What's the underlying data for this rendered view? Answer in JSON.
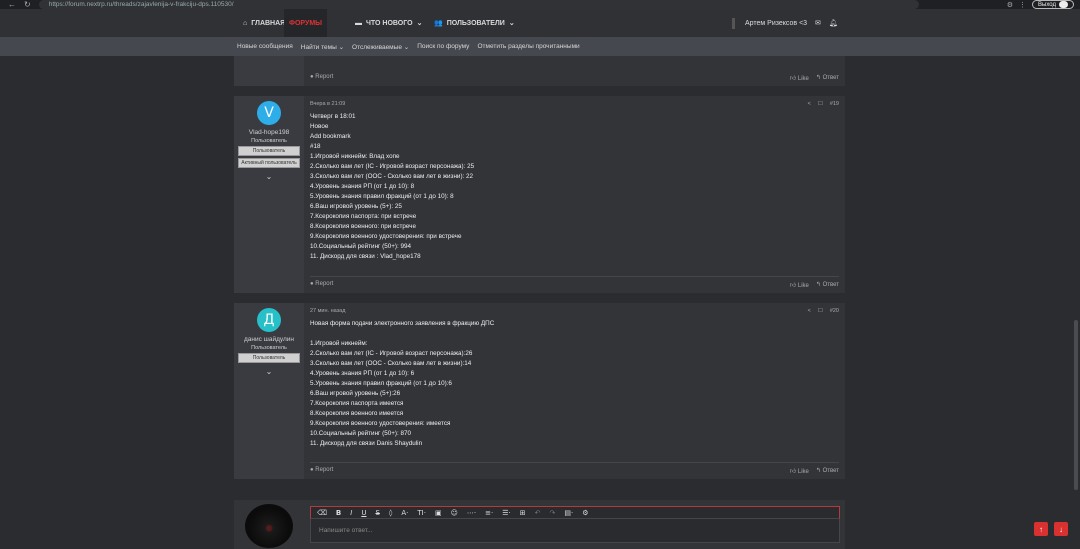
{
  "browser": {
    "url": "https://forum.nextrp.ru/threads/zajavlenija-v-frakciju-dps.110530/",
    "exit_label": "Выход"
  },
  "nav": {
    "home": "ГЛАВНАЯ",
    "forums": "ФОРУМЫ",
    "whats_new": "ЧТО НОВОГО",
    "users": "ПОЛЬЗОВАТЕЛИ",
    "username": "Артем Ризексов <3"
  },
  "subnav": [
    "Новые сообщения",
    "Найти темы",
    "Отслеживаемые",
    "Поиск по форуму",
    "Отметить разделы прочитанными"
  ],
  "top_post_footer": {
    "report": "Report",
    "like": "Like",
    "reply": "Ответ"
  },
  "posts": [
    {
      "avatar_letter": "V",
      "avatar_color": "#2eaee8",
      "name": "Vlad-hope198",
      "title": "Пользователь",
      "badges": [
        "Пользователь",
        "Активный пользователь"
      ],
      "time": "Вчера в 21:09",
      "number": "#19",
      "lines": [
        "Четверг в 18:01",
        "Новое",
        "Add bookmark",
        "#18",
        "1.Игровой никнейм: Влад хопе",
        "2.Сколько вам лет (IC - Игровой возраст персонажа): 25",
        "3.Сколько вам лет (OOC - Сколько вам лет в жизни): 22",
        "4.Уровень знания РП (от 1 до 10): 8",
        "5.Уровень знания правил фракций (от 1 до 10): 8",
        "6.Ваш игровой уровень (5+): 25",
        "7.Ксерокопия паспорта: при встрече",
        "8.Ксерокопия военного: при встрече",
        "9.Ксерокопия военного удостоверения: при встрече",
        "10.Социальный рейтинг (50+): 994",
        "11. Дискорд для связи : Vlad_hope178"
      ],
      "report": "Report",
      "like": "Like",
      "reply": "Ответ"
    },
    {
      "avatar_letter": "Д",
      "avatar_color": "#27c0c8",
      "name": "данис шайдулин",
      "title": "Пользователь",
      "badges": [
        "Пользователь"
      ],
      "time": "27 мин. назад",
      "number": "#20",
      "lines": [
        "Новая форма подачи электронного заявления в фракцию ДПС",
        "",
        "1.Игровой никнейм:",
        "2.Сколько вам лет (IC - Игровой возраст персонажа):26",
        "3.Сколько вам лет (OOC - Сколько вам лет в жизни):14",
        "4.Уровень знания РП (от 1 до 10): 6",
        "5.Уровень знания правил фракций (от 1 до 10):6",
        "6.Ваш игровой уровень (5+):26",
        "7.Ксерокопия паспорта имеется",
        "8.Ксерокопия военного имеется",
        "9.Ксерокопия военного удостоверения: имеется",
        "10.Социальный рейтинг (50+): 870",
        "11. Дискорд для связи Danis Shaydulin"
      ],
      "report": "Report",
      "like": "Like",
      "reply": "Ответ"
    }
  ],
  "editor": {
    "placeholder": "Напишите ответ..."
  },
  "colors": {
    "accent": "#d93030",
    "background": "#2b2c30",
    "post_bg": "#323438"
  }
}
